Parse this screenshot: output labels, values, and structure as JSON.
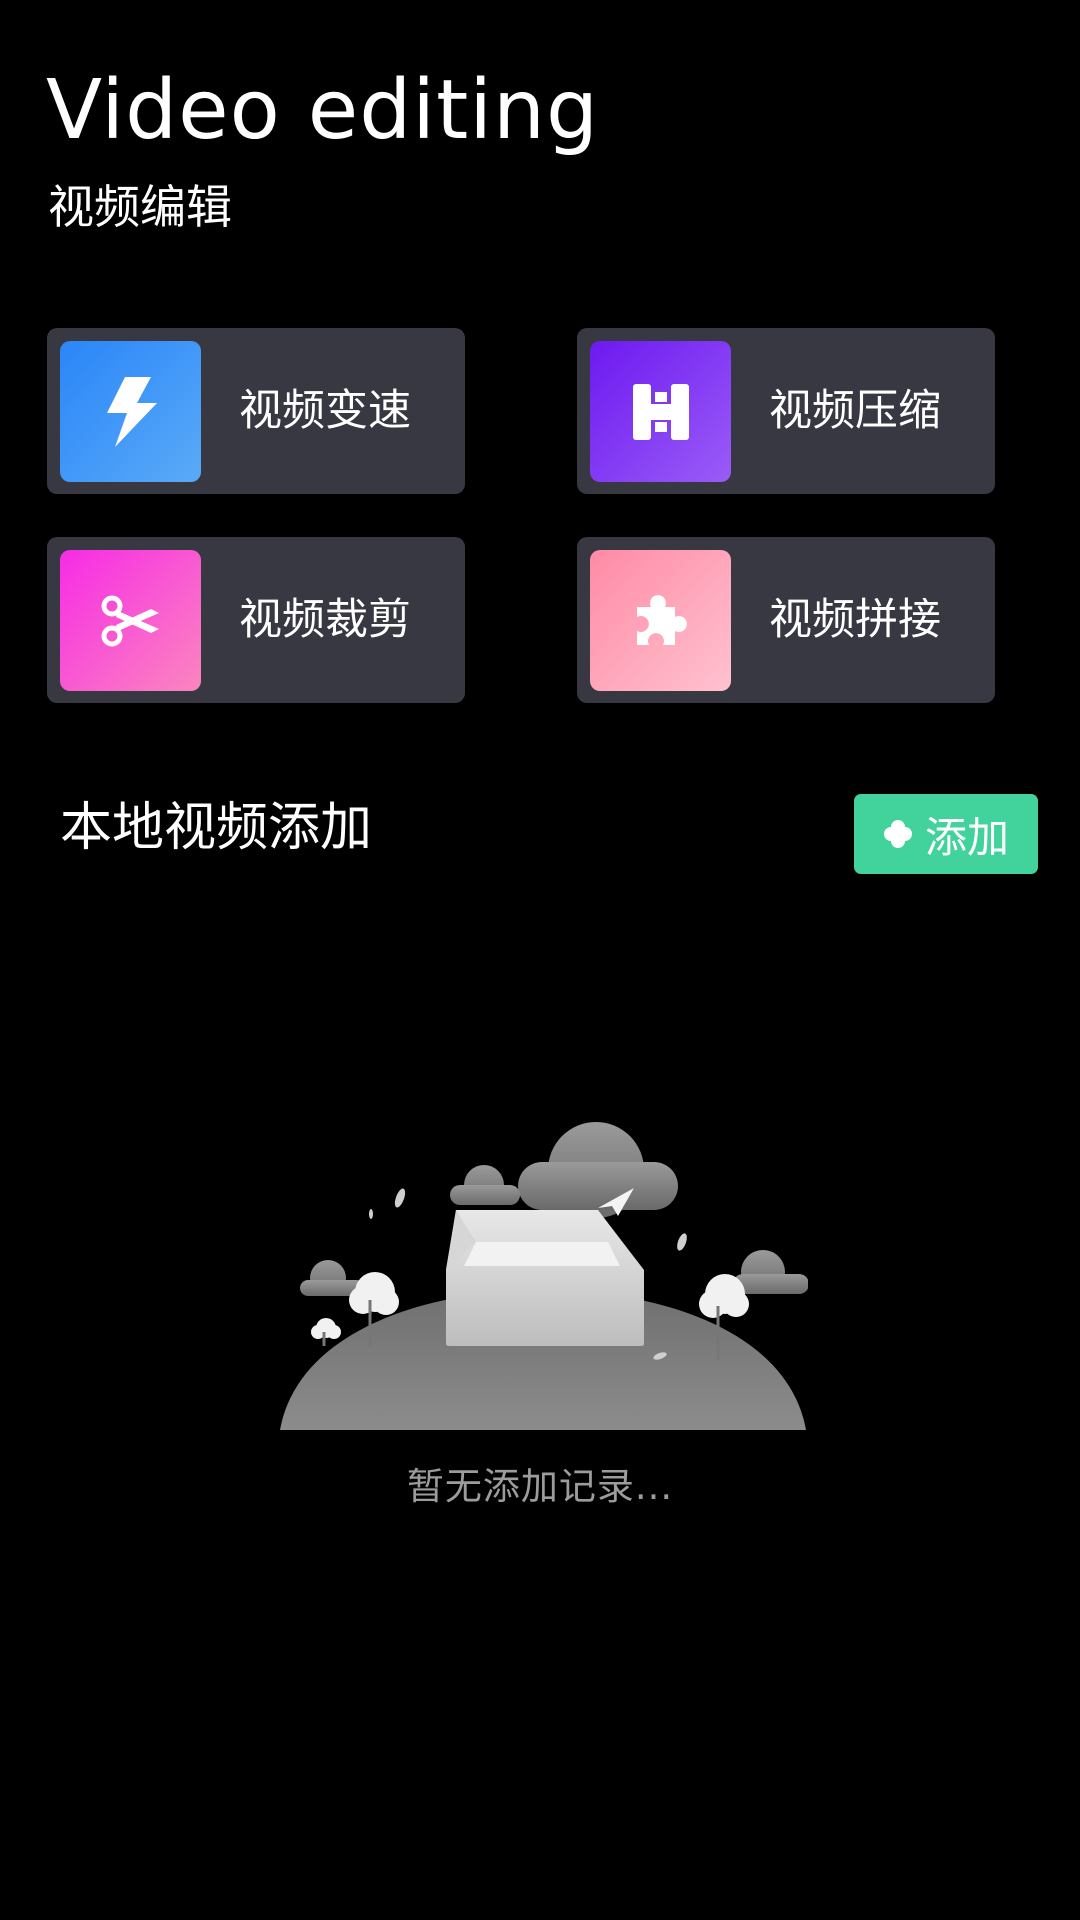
{
  "header": {
    "title": "Video editing",
    "subtitle": "视频编辑"
  },
  "tools": [
    {
      "label": "视频变速",
      "icon": "lightning-icon",
      "color": "#2a86f8"
    },
    {
      "label": "视频压缩",
      "icon": "compress-icon",
      "color": "#6d19f0"
    },
    {
      "label": "视频裁剪",
      "icon": "scissors-icon",
      "color": "#f72be6"
    },
    {
      "label": "视频拼接",
      "icon": "puzzle-icon",
      "color": "#ff8aa6"
    }
  ],
  "local": {
    "title": "本地视频添加",
    "add_label": "添加",
    "add_icon": "clover-icon",
    "add_color": "#42d39c"
  },
  "empty_state": {
    "text": "暂无添加记录...",
    "illustration": "empty-box-illustration"
  },
  "colors": {
    "background": "#000000",
    "card": "#383842"
  }
}
